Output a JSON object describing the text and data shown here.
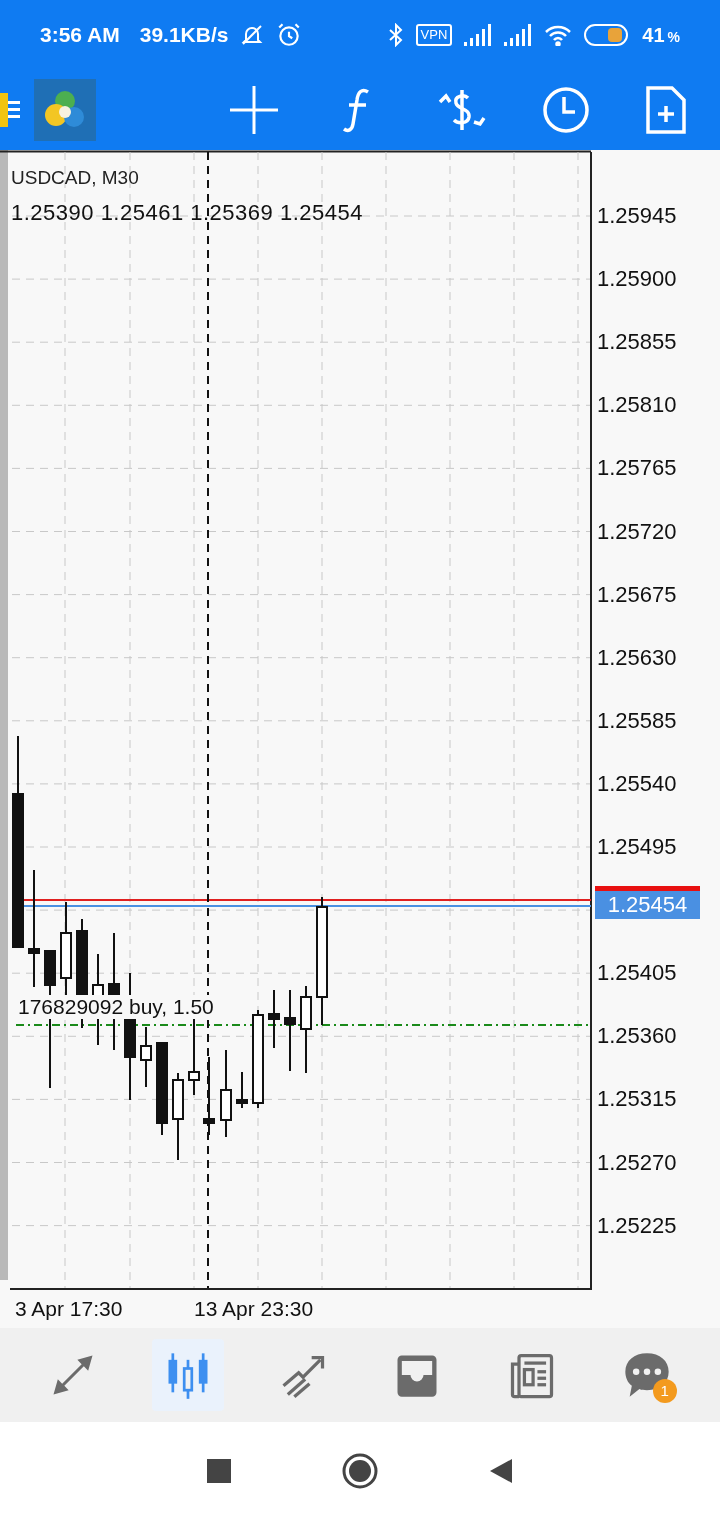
{
  "status_bar": {
    "time": "3:56 AM",
    "speed": "39.1KB/s",
    "vpn": "VPN",
    "battery": "41",
    "percent_sign": "%"
  },
  "chart": {
    "symbol": "USDCAD, M30",
    "ohlc": "1.25390 1.25461 1.25369 1.25454",
    "price_labels": [
      "1.25945",
      "1.25900",
      "1.25855",
      "1.25810",
      "1.25765",
      "1.25720",
      "1.25675",
      "1.25630",
      "1.25585",
      "1.25540",
      "1.25495",
      "1.25454",
      "1.25405",
      "1.25360",
      "1.25315",
      "1.25270",
      "1.25225"
    ],
    "order_label": "176829092 buy, 1.50",
    "time_labels": [
      "3 Apr 17:30",
      "13 Apr 23:30"
    ]
  },
  "bottom_nav": [
    {
      "selected": false
    },
    {
      "selected": true
    },
    {
      "selected": false
    },
    {
      "selected": false
    },
    {
      "selected": false
    },
    {
      "selected": false,
      "badge": "1"
    }
  ]
}
